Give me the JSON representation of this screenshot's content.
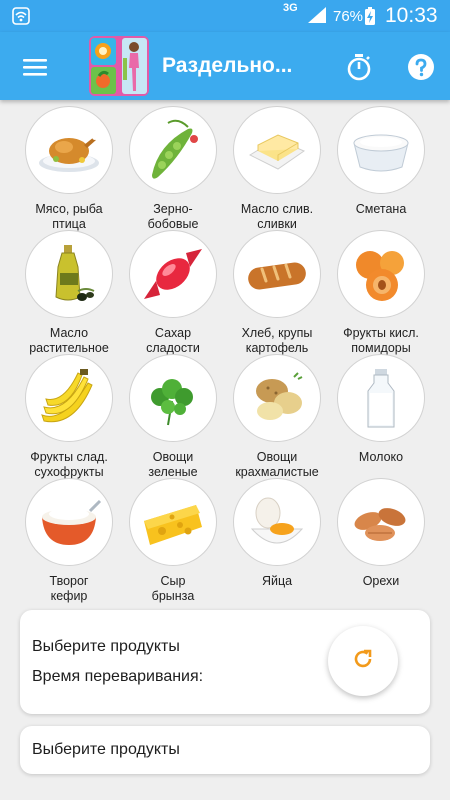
{
  "status_bar": {
    "network": "3G",
    "battery": "76%",
    "time": "10:33"
  },
  "app_bar": {
    "title": "Раздельно..."
  },
  "products": [
    {
      "label": "Мясо, рыба\nптица",
      "icon": "roast-chicken-icon"
    },
    {
      "label": "Зерно-\nбобовые",
      "icon": "pea-pod-icon"
    },
    {
      "label": "Масло слив.\nсливки",
      "icon": "butter-icon"
    },
    {
      "label": "Сметана",
      "icon": "sour-cream-icon"
    },
    {
      "label": "Масло\nрастительное",
      "icon": "olive-oil-icon"
    },
    {
      "label": "Сахар\nсладости",
      "icon": "candy-icon"
    },
    {
      "label": "Хлеб, крупы\nкартофель",
      "icon": "bread-icon"
    },
    {
      "label": "Фрукты кисл.\nпомидоры",
      "icon": "peach-icon"
    },
    {
      "label": "Фрукты слад.\nсухофрукты",
      "icon": "banana-icon"
    },
    {
      "label": "Овощи\nзеленые",
      "icon": "parsley-icon"
    },
    {
      "label": "Овощи\nкрахмалистые",
      "icon": "potato-icon"
    },
    {
      "label": "Молоко",
      "icon": "milk-bottle-icon"
    },
    {
      "label": "Творог\nкефир",
      "icon": "cottage-cheese-icon"
    },
    {
      "label": "Сыр\nбрынза",
      "icon": "cheese-icon"
    },
    {
      "label": "Яйца",
      "icon": "egg-icon"
    },
    {
      "label": "Орехи",
      "icon": "almonds-icon"
    }
  ],
  "summary_card": {
    "line1": "Выберите продукты",
    "line2": "Время переваривания:"
  },
  "result_card": {
    "text": "Выберите продукты"
  },
  "colors": {
    "app_bar": "#3cabef",
    "accent": "#f29a1b"
  }
}
